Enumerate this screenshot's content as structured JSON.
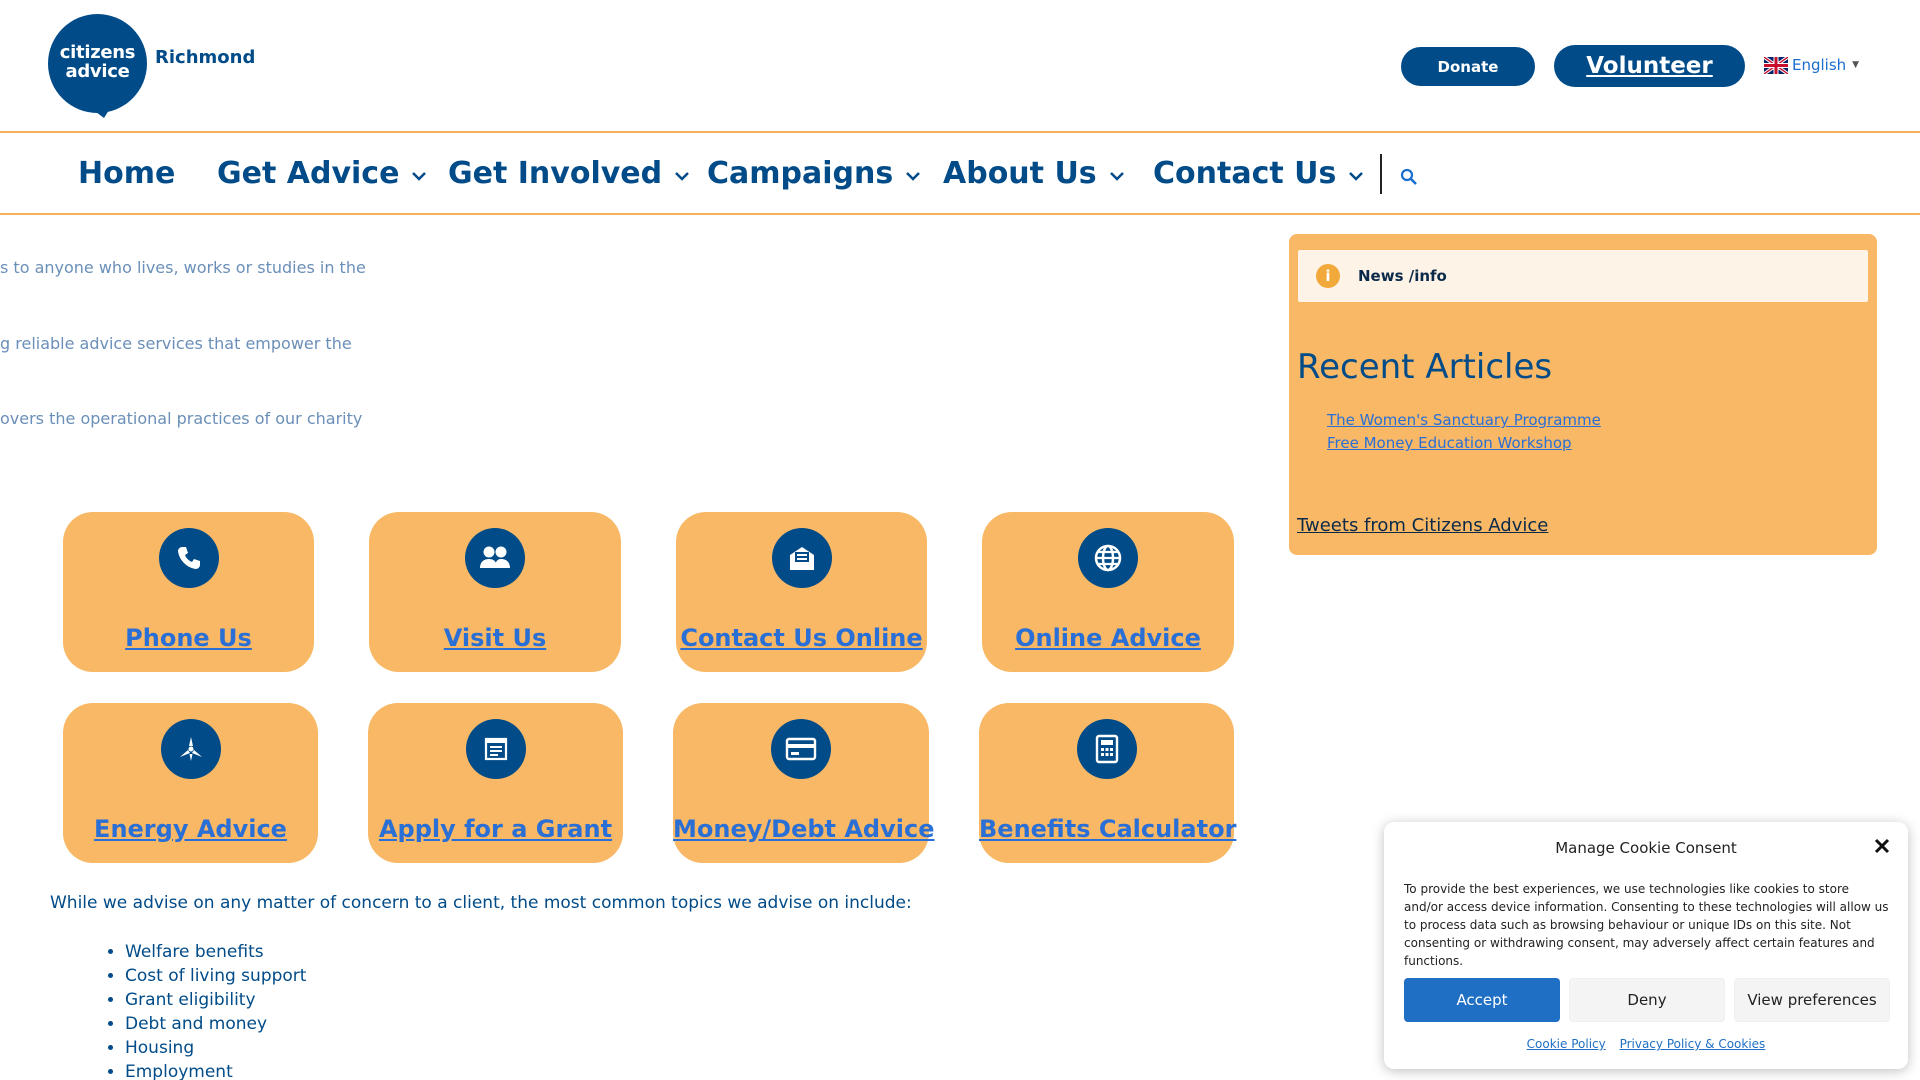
{
  "brand": {
    "logo_line1": "citizens",
    "logo_line2": "advice",
    "location": "Richmond",
    "primary_color": "#004b88",
    "accent_color": "#f8b865"
  },
  "header": {
    "donate_label": "Donate",
    "volunteer_label": "Volunteer",
    "language": "English"
  },
  "nav": {
    "items": [
      {
        "label": "Home"
      },
      {
        "label": "Get Advice"
      },
      {
        "label": "Get Involved"
      },
      {
        "label": "Campaigns"
      },
      {
        "label": "About Us"
      },
      {
        "label": "Contact Us"
      }
    ],
    "search_icon": "search-icon"
  },
  "intro": [
    "s to anyone who lives, works or studies in the",
    "g reliable advice services that empower the",
    "overs the operational practices of our charity"
  ],
  "tiles": [
    {
      "label": "Phone Us",
      "icon": "phone-icon"
    },
    {
      "label": "Visit Us",
      "icon": "people-icon"
    },
    {
      "label": "Contact Us Online",
      "icon": "envelope-icon"
    },
    {
      "label": "Online Advice",
      "icon": "globe-icon"
    },
    {
      "label": "Energy Advice",
      "icon": "energy-icon"
    },
    {
      "label": "Apply for a Grant",
      "icon": "form-icon"
    },
    {
      "label": "Money/Debt Advice",
      "icon": "card-icon"
    },
    {
      "label": "Benefits Calculator",
      "icon": "calculator-icon"
    }
  ],
  "topics": {
    "intro": "While we advise on any matter of concern to a client, the most common topics we advise on include:",
    "items": [
      "Welfare benefits",
      "Cost of living support",
      "Grant eligibility",
      "Debt and money",
      "Housing",
      "Employment"
    ]
  },
  "sidebar": {
    "news_label": "News /info",
    "recent_title": "Recent Articles",
    "articles": [
      "The Women's Sanctuary Programme",
      "Free Money Education Workshop"
    ],
    "tweets_label": "Tweets from Citizens Advice"
  },
  "cookie": {
    "title": "Manage Cookie Consent",
    "body": "To provide the best experiences, we use technologies like cookies to store and/or access device information. Consenting to these technologies will allow us to process data such as browsing behaviour or unique IDs on this site. Not consenting or withdrawing consent, may adversely affect certain features and functions.",
    "accept_label": "Accept",
    "deny_label": "Deny",
    "prefs_label": "View preferences",
    "cookie_policy_label": "Cookie Policy",
    "privacy_label": "Privacy Policy & Cookies"
  }
}
